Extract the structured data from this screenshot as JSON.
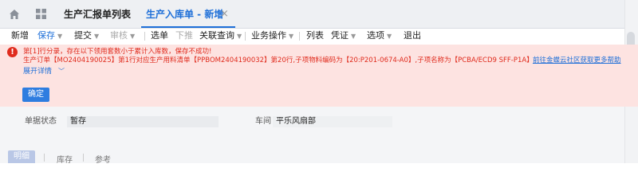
{
  "tabs": {
    "home_icon": "home-icon",
    "apps_icon": "grid-icon",
    "items": [
      {
        "label": "生产汇报单列表"
      },
      {
        "label": "生产入库单 - 新增"
      }
    ],
    "close_glyph": "×"
  },
  "toolbar": {
    "new": "新增",
    "save": "保存",
    "submit": "提交",
    "audit": "审核",
    "select_order": "选单",
    "push_down": "下推",
    "related_query": "关联查询",
    "business_ops": "业务操作",
    "list": "列表",
    "voucher": "凭证",
    "options": "选项",
    "exit": "退出",
    "separator": "|"
  },
  "error": {
    "icon_text": "!",
    "line1": "第[1]行分录，存在以下领用套数小于累计入库数，保存不成功!",
    "line2": "生产订单【MO2404190025】第1行对应生产用料清单【PPBOM2404190032】第20行,子项物料编码为【20:P201-0674-A0】,子项名称为【PCBA/ECD9 SFF-P1A】",
    "help_link": "前往金蝶云社区获取更多帮助",
    "expand_label": "展开详情",
    "ok_label": "确定"
  },
  "form": {
    "status_label": "单据状态",
    "status_value": "暂存",
    "workshop_label": "车间",
    "workshop_value": "平乐风扇部"
  },
  "bottom_tabs": {
    "active": "明细",
    "items": [
      "库存",
      "参考"
    ]
  },
  "colors": {
    "accent": "#1e6fd8",
    "error_text": "#e02b1d",
    "error_bg": "#fde3e1"
  }
}
